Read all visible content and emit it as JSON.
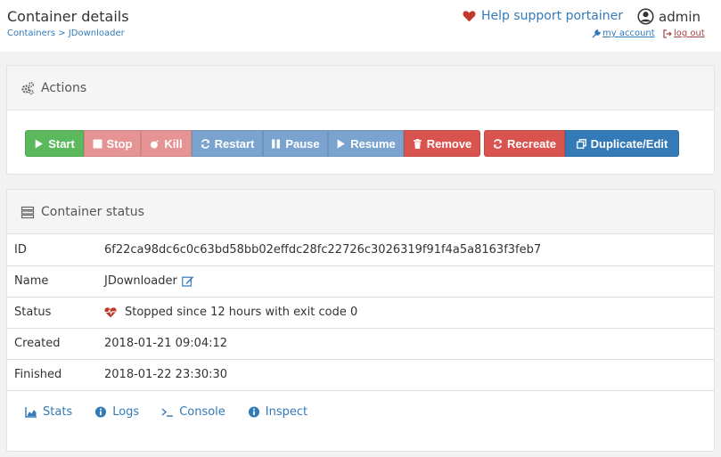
{
  "header": {
    "title": "Container details",
    "breadcrumb": {
      "parent": "Containers",
      "separator": ">",
      "current": "JDownloader"
    },
    "help_label": "Help support portainer",
    "username": "admin",
    "my_account": "my account",
    "log_out": "log out"
  },
  "actions": {
    "heading": "Actions",
    "buttons": {
      "start": "Start",
      "stop": "Stop",
      "kill": "Kill",
      "restart": "Restart",
      "pause": "Pause",
      "resume": "Resume",
      "remove": "Remove",
      "recreate": "Recreate",
      "duplicate": "Duplicate/Edit"
    }
  },
  "status": {
    "heading": "Container status",
    "rows": {
      "id": {
        "label": "ID",
        "value": "6f22ca98dc6c0c63bd58bb02effdc28fc22726c3026319f91f4a5a8163f3feb7"
      },
      "name": {
        "label": "Name",
        "value": "JDownloader"
      },
      "status": {
        "label": "Status",
        "value": "Stopped since 12 hours with exit code 0"
      },
      "created": {
        "label": "Created",
        "value": "2018-01-21 09:04:12"
      },
      "finished": {
        "label": "Finished",
        "value": "2018-01-22 23:30:30"
      }
    },
    "links": {
      "stats": "Stats",
      "logs": "Logs",
      "console": "Console",
      "inspect": "Inspect"
    }
  },
  "colors": {
    "success": "#5cb85c",
    "danger": "#d9534f",
    "primary": "#337ab7",
    "link": "#337ab7",
    "heart": "#c0392b"
  }
}
